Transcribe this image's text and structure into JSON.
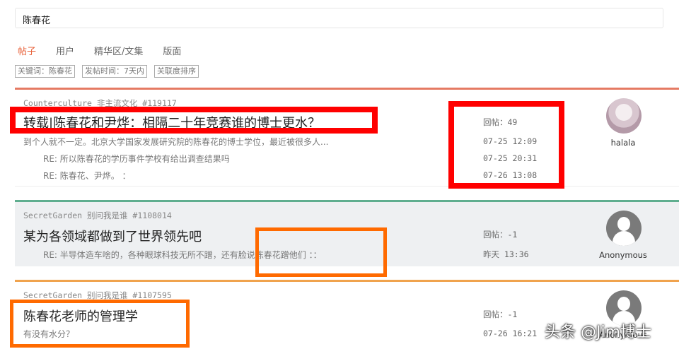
{
  "search": {
    "value": "陈春花"
  },
  "tabs": [
    {
      "label": "帖子",
      "active": true
    },
    {
      "label": "用户",
      "active": false
    },
    {
      "label": "精华区/文集",
      "active": false
    },
    {
      "label": "版面",
      "active": false
    }
  ],
  "filters": [
    {
      "label": "关键词：陈春花"
    },
    {
      "label": "发帖时间：7天内"
    },
    {
      "label": "关联度排序"
    }
  ],
  "colors": {
    "accent": "#e8613a",
    "card1_border": "#e57a63",
    "card2_border": "#5fae8f",
    "card3_border": "#f0a34e",
    "highlight_red": "#ff0000",
    "highlight_orange": "#ff6a00"
  },
  "posts": [
    {
      "meta": "Counterculture 非主流文化 #119117",
      "title": "转载|陈春花和尹烨：相隔二十年竞赛谁的博士更水？",
      "snippet": "到个人就不一定。北京大学国家发展研究院的陈春花的博士学位，最近被很多人...",
      "replies": [
        "RE: 所以陈春花的学历事件学校有给出调查结果吗",
        "RE: 陈春花、尹烨。 ："
      ],
      "stats": [
        "回帖：49",
        "07-25 12:09",
        "07-25 20:31",
        "07-26 13:08"
      ],
      "user": "halala",
      "avatar_icon": "anime-avatar"
    },
    {
      "meta": "SecretGarden 别问我是谁 #1108014",
      "title": "某为各领域都做到了世界领先吧",
      "replies": [
        "RE: 半导体造车啥的，各种眼球科技无所不蹭，还有脸说陈春花蹭他们 ：："
      ],
      "stats": [
        "回帖：-1",
        "昨天 13:36"
      ],
      "user": "Anonymous",
      "avatar_icon": "default-user-icon"
    },
    {
      "meta": "SecretGarden 别问我是谁 #1107595",
      "title": "陈春花老师的管理学",
      "snippet": "有没有水分？",
      "stats": [
        "回帖：-1",
        "07-26 16:21"
      ],
      "user": "Anonymous",
      "avatar_icon": "default-user-icon"
    }
  ],
  "watermark": "头条 @Jim博士"
}
